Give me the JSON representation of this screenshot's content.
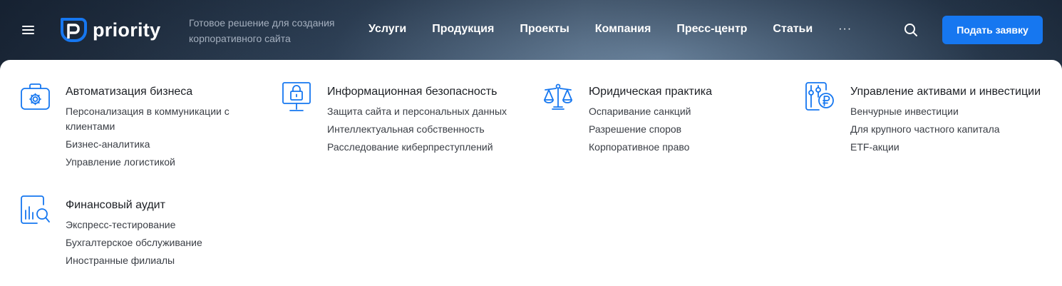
{
  "header": {
    "logo_text": "priority",
    "tagline": "Готовое решение для создания корпоративного сайта",
    "nav": [
      {
        "label": "Услуги"
      },
      {
        "label": "Продукция"
      },
      {
        "label": "Проекты"
      },
      {
        "label": "Компания"
      },
      {
        "label": "Пресс-центр"
      },
      {
        "label": "Статьи"
      }
    ],
    "more_label": "···",
    "cta_label": "Подать заявку",
    "icons": {
      "menu": "hamburger-icon",
      "logo": "priority-logo-icon",
      "search": "search-icon"
    }
  },
  "colors": {
    "accent": "#1677f0",
    "text_dark": "#1c1f24",
    "text_link": "#3a3e45",
    "icon_stroke": "#1677f0"
  },
  "menu": {
    "categories": [
      {
        "title": "Автоматизация бизнеса",
        "icon": "briefcase-gear-icon",
        "links": [
          "Персонализация в коммуникации с клиентами",
          "Бизнес-аналитика",
          "Управление логистикой"
        ]
      },
      {
        "title": "Информационная безопасность",
        "icon": "monitor-lock-icon",
        "links": [
          "Защита сайта и персональных данных",
          "Интеллектуальная собственность",
          "Расследование киберпреступлений"
        ]
      },
      {
        "title": "Юридическая практика",
        "icon": "scales-icon",
        "links": [
          "Оспаривание санкций",
          "Разрешение споров",
          "Корпоративное право"
        ]
      },
      {
        "title": "Управление активами и инвестиции",
        "icon": "sliders-ruble-icon",
        "links": [
          "Венчурные инвестиции",
          "Для крупного частного капитала",
          "ETF-акции"
        ]
      },
      {
        "title": "Финансовый аудит",
        "icon": "report-magnifier-icon",
        "links": [
          "Экспресс-тестирование",
          "Бухгалтерское обслуживание",
          "Иностранные филиалы"
        ]
      }
    ]
  }
}
